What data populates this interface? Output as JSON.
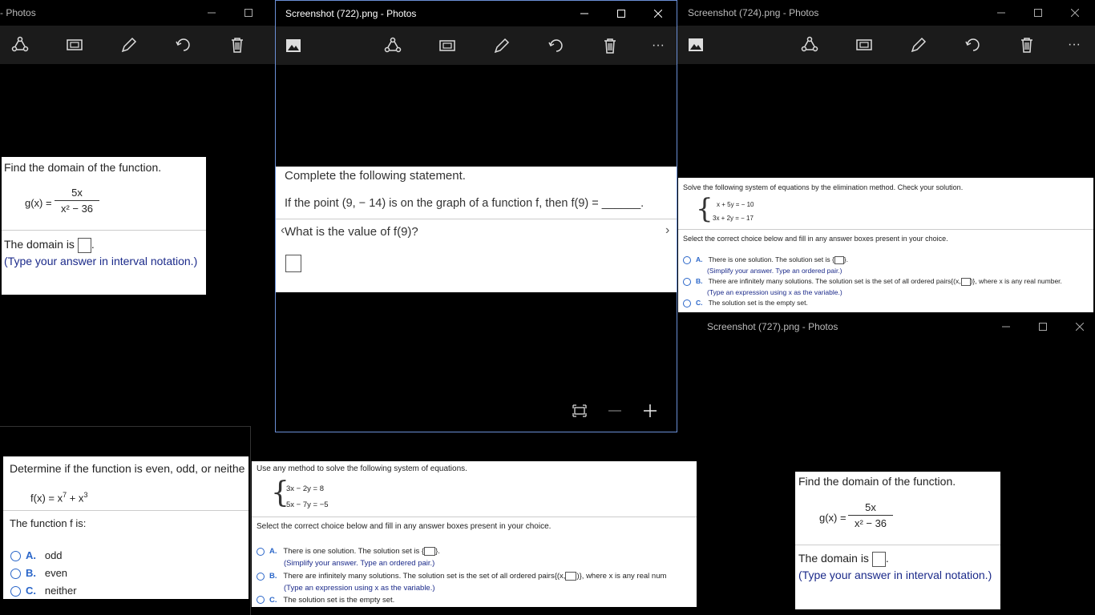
{
  "win_left": {
    "title": "- Photos",
    "question": {
      "heading": "Find the domain of the function.",
      "func_lhs": "g(x) =",
      "numerator": "5x",
      "denominator": "x² − 36",
      "answer_prefix": "The domain is",
      "hint": "(Type your answer in interval notation.)"
    }
  },
  "win_center": {
    "title": "Screenshot (722).png - Photos",
    "statement": "Complete the following statement.",
    "premise": "If the point (9, − 14) is on the graph of a function f, then f(9) = ______.",
    "prompt": "What is the value of f(9)?"
  },
  "win_right": {
    "title": "Screenshot (724).png - Photos",
    "heading": "Solve the following system of equations by the elimination method. Check your solution.",
    "eq1": "x + 5y = − 10",
    "eq2": "3x + 2y = − 17",
    "select": "Select the correct choice below and fill in any answer boxes present in your choice.",
    "choiceA_letter": "A.",
    "choiceA": "There is one solution. The solution set is {",
    "choiceA_end": "}.",
    "choiceA_hint": "(Simplify your answer. Type an ordered pair.)",
    "choiceB_letter": "B.",
    "choiceB": "There are infinitely many solutions. The solution set is the set of all ordered pairs{(x,",
    "choiceB_end": ")}, where x is any real number.",
    "choiceB_hint": "(Type an expression using x as the variable.)",
    "choiceC_letter": "C.",
    "choiceC": "The solution set is the empty set."
  },
  "win_br": {
    "title": "Screenshot (727).png - Photos",
    "question": {
      "heading": "Find the domain of the function.",
      "func_lhs": "g(x) =",
      "numerator": "5x",
      "denominator": "x² − 36",
      "answer_prefix": "The domain is",
      "hint": "(Type your answer in interval notation.)"
    }
  },
  "win_bl": {
    "heading": "Determine if the function is even, odd, or neithe",
    "func_main": "f(x) = x",
    "exp1": "7",
    "plus": " + x",
    "exp2": "3",
    "statement": "The function f is:",
    "a_letter": "A.",
    "a": "odd",
    "b_letter": "B.",
    "b": "even",
    "c_letter": "C.",
    "c": "neither"
  },
  "win_bc": {
    "heading": "Use any method to solve the following system of equations.",
    "eq1": "3x − 2y = 8",
    "eq2": "5x − 7y = −5",
    "select": "Select the correct choice below and fill in any answer boxes present in your choice.",
    "choiceA_letter": "A.",
    "choiceA": "There is one solution. The solution set is {",
    "choiceA_end": "}.",
    "choiceA_hint": "(Simplify your answer. Type an ordered pair.)",
    "choiceB_letter": "B.",
    "choiceB": "There are infinitely many solutions. The solution set is the set of all ordered pairs{(x,",
    "choiceB_end": ")}, where x is any real num",
    "choiceB_hint": "(Type an expression using x as the variable.)",
    "choiceC_letter": "C.",
    "choiceC": "The solution set is the empty set."
  },
  "colors": {
    "accent_blue": "#2a66c9",
    "hint_navy": "#1b2a8a",
    "toolbar_bg": "#1b1b1b"
  },
  "icons": [
    "share-icon",
    "slideshow-icon",
    "edit-icon",
    "rotate-icon",
    "delete-icon",
    "more-icon",
    "picture-icon",
    "fit-icon",
    "zoom-out-icon",
    "zoom-in-icon",
    "minimize-icon",
    "maximize-icon",
    "close-icon"
  ]
}
